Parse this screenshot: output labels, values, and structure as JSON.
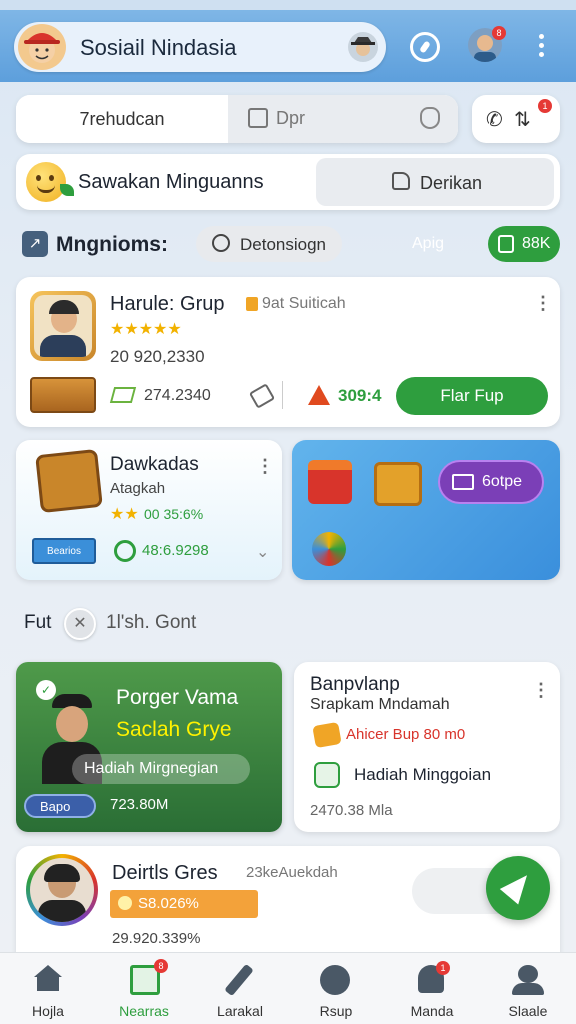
{
  "header": {
    "title": "Sosiail Nindasia",
    "notif_count": "8"
  },
  "tabs": {
    "left": "7rehudcan",
    "right": "Dpr",
    "call_badge": "1"
  },
  "banner": {
    "title": "Sawakan Minguanns",
    "button": "Derikan"
  },
  "section": {
    "title": "Mngnioms:",
    "chip": "Detonsiogn",
    "aside": "Apig",
    "badge": "88K"
  },
  "group_card": {
    "title": "Harule: Grup",
    "tag": "9at Suiticah",
    "rating": 5,
    "count": "20 920,2330",
    "date": "274.2340",
    "score": "309:4",
    "button": "Flar Fup"
  },
  "small_card": {
    "title": "Dawkadas",
    "subtitle": "Atagkah",
    "rating_text": "00 35:6%",
    "badge": "Bearios",
    "value": "48:6.9298"
  },
  "promo_card": {
    "button": "6otpe"
  },
  "divider": {
    "label": "Fut",
    "text": "1l'sh. Gont"
  },
  "feature_card": {
    "line1": "Porger Vama",
    "line2": "Saclah Grye",
    "sub": "Hadiah Mirgnegian",
    "badge": "Bapo",
    "value": "723.80M"
  },
  "info_card": {
    "title": "Banpvlanp",
    "subtitle": "Srapkam Mndamah",
    "offer": "Ahicer Bup 80 m0",
    "item": "Hadiah Minggoian",
    "value": "2470.38 Mla"
  },
  "bottom_card": {
    "title": "Deirtls Gres",
    "tag": "23keAuekdah",
    "pill": "S8.026%",
    "value": "29.920.339%"
  },
  "nav": {
    "items": [
      {
        "label": "Hojla",
        "icon": "home-icon"
      },
      {
        "label": "Nearras",
        "icon": "news-icon",
        "badge": "8"
      },
      {
        "label": "Larakal",
        "icon": "pen-icon"
      },
      {
        "label": "Rsup",
        "icon": "globe-icon"
      },
      {
        "label": "Manda",
        "icon": "bell-icon",
        "badge": "1"
      },
      {
        "label": "Slaale",
        "icon": "profile-icon"
      }
    ]
  },
  "colors": {
    "green": "#2e9e3e",
    "blue": "#3b8fd9",
    "purple": "#7b3fb7"
  }
}
